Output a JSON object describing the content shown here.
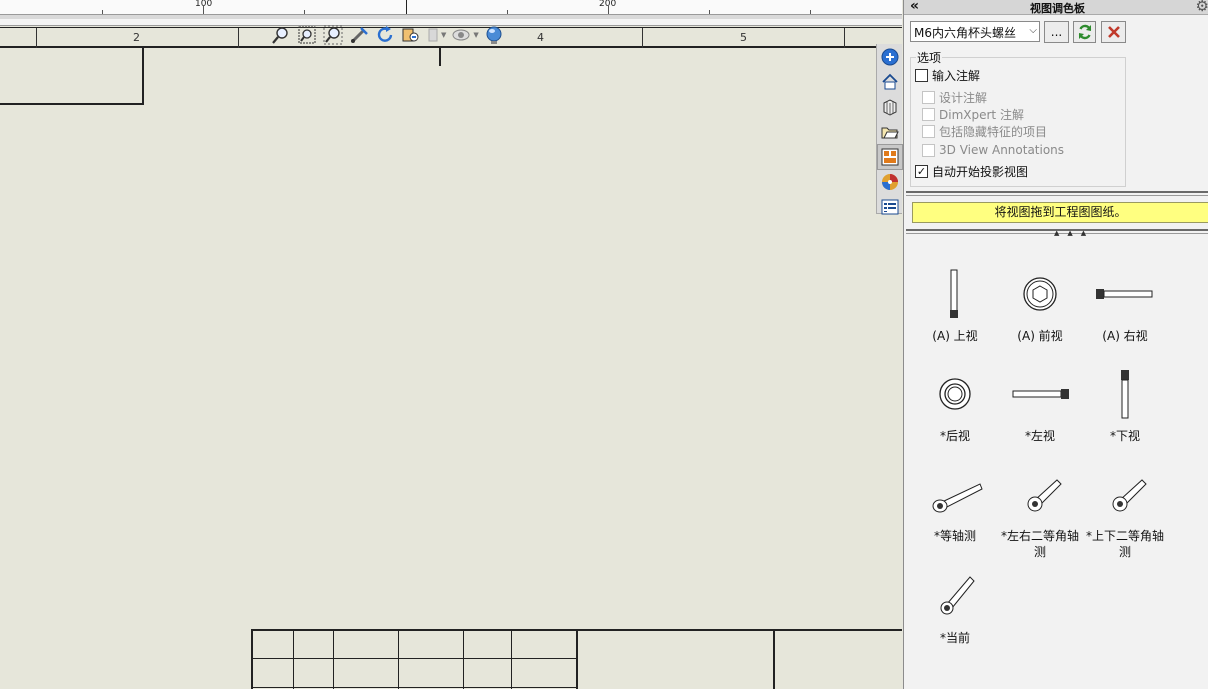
{
  "ruler": {
    "labels": [
      "100",
      "200"
    ]
  },
  "zones": {
    "labels": [
      "2",
      "4",
      "5"
    ]
  },
  "view_toolbar": {
    "icons": [
      "zoom-to-fit-icon",
      "zoom-to-area-icon",
      "zoom-in-out-icon",
      "previous-view-icon",
      "rotate-icon",
      "section-view-icon",
      "hide-show-icon",
      "appearance-icon"
    ]
  },
  "task_pane": {
    "tabs": [
      "solidworks-resources-icon",
      "home-icon",
      "design-library-icon",
      "file-explorer-icon",
      "view-palette-icon",
      "appearances-icon",
      "custom-properties-icon"
    ]
  },
  "panel": {
    "collapse_label": "«",
    "title": "视图调色板",
    "model_select": "M6内六角杯头螺丝",
    "browse_label": "...",
    "options_legend": "选项",
    "options": {
      "import_annotations": "输入注解",
      "design_annotations": "设计注解",
      "dimxpert_annotations": "DimXpert 注解",
      "hidden_features": "包括隐藏特征的项目",
      "view_3d_annotations": "3D View Annotations",
      "auto_projected": "自动开始投影视图"
    },
    "checkmark": "✓",
    "hint": "将视图拖到工程图图纸。",
    "views": [
      "(A) 上视",
      "(A) 前视",
      "(A) 右视",
      "*后视",
      "*左视",
      "*下视",
      "*等轴测",
      "*左右二等角轴测",
      "*上下二等角轴测",
      "*当前"
    ]
  },
  "colors": {
    "sheet_background": "#e6e6da",
    "hint_background": "#ffff80",
    "close_red": "#c0392b",
    "refresh_green": "#2e8b2e"
  }
}
